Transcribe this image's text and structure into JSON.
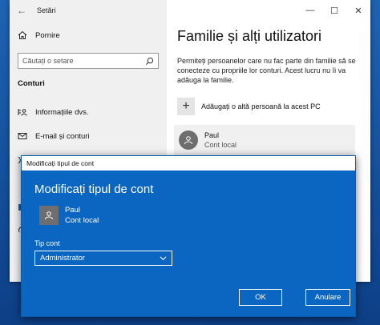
{
  "window": {
    "app_title": "Setări",
    "back_glyph": "←",
    "minimize_glyph": "—",
    "maximize_glyph": "☐",
    "close_glyph": "✕"
  },
  "sidebar": {
    "home_label": "Pornire",
    "search_placeholder": "Căutați o setare",
    "section_heading": "Conturi",
    "items": [
      {
        "label": "Informațiile dvs.",
        "icon": "person-card-icon"
      },
      {
        "label": "E-mail și conturi",
        "icon": "mail-icon"
      }
    ]
  },
  "main": {
    "title": "Familie și alți utilizatori",
    "description": "Permiteți persoanelor care nu fac parte din familie să se conecteze cu propriile lor conturi. Acest lucru nu îi va adăuga la familie.",
    "add_label": "Adăugați o altă persoană la acest PC",
    "add_glyph": "+",
    "user": {
      "name": "Paul",
      "type": "Cont local"
    }
  },
  "dialog": {
    "titlebar": "Modificați tipul de cont",
    "heading": "Modificați tipul de cont",
    "user": {
      "name": "Paul",
      "type": "Cont local"
    },
    "type_label": "Tip cont",
    "selected_type": "Administrator",
    "ok_label": "OK",
    "cancel_label": "Anulare"
  },
  "colors": {
    "dialog_bg": "#0b66c2",
    "sidebar_bg": "#f0f0f0",
    "avatar_bg": "#6e6e6e"
  }
}
